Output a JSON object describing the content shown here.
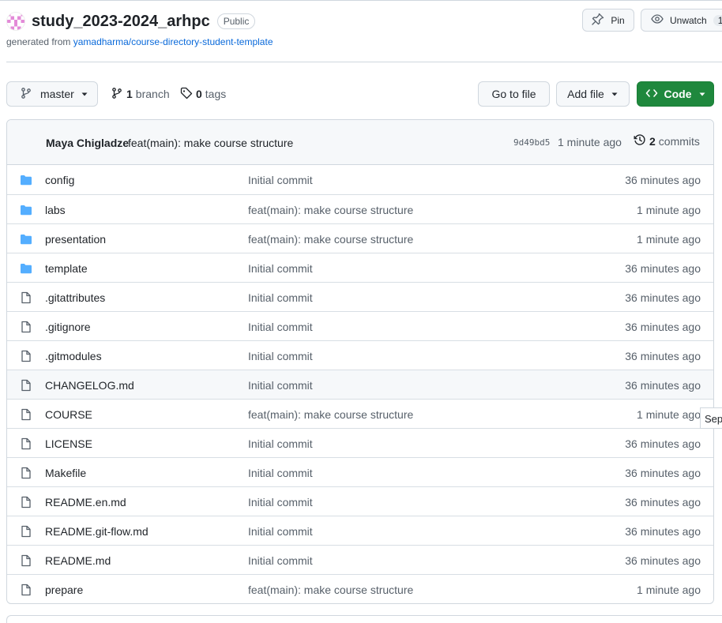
{
  "repo": {
    "name": "study_2023-2024_arhpc",
    "visibility": "Public",
    "generated_prefix": "generated from ",
    "template_link": "yamadharma/course-directory-student-template"
  },
  "actions": {
    "pin_label": "Pin",
    "unwatch_label": "Unwatch",
    "watch_count": "1"
  },
  "toolbar": {
    "branch_name": "master",
    "branch_count": "1",
    "branch_word": "branch",
    "tags_count": "0",
    "tags_word": "tags",
    "goto_label": "Go to file",
    "addfile_label": "Add file",
    "code_label": "Code"
  },
  "latest_commit": {
    "author": "Maya Chigladze",
    "message": "feat(main): make course structure",
    "sha": "9d49bd5",
    "time": "1 minute ago",
    "commits_count": "2",
    "commits_word": "commits"
  },
  "files": [
    {
      "name": "config",
      "type": "dir",
      "message": "Initial commit",
      "time": "36 minutes ago"
    },
    {
      "name": "labs",
      "type": "dir",
      "message": "feat(main): make course structure",
      "time": "1 minute ago"
    },
    {
      "name": "presentation",
      "type": "dir",
      "message": "feat(main): make course structure",
      "time": "1 minute ago"
    },
    {
      "name": "template",
      "type": "dir",
      "message": "Initial commit",
      "time": "36 minutes ago"
    },
    {
      "name": ".gitattributes",
      "type": "file",
      "message": "Initial commit",
      "time": "36 minutes ago"
    },
    {
      "name": ".gitignore",
      "type": "file",
      "message": "Initial commit",
      "time": "36 minutes ago"
    },
    {
      "name": ".gitmodules",
      "type": "file",
      "message": "Initial commit",
      "time": "36 minutes ago"
    },
    {
      "name": "CHANGELOG.md",
      "type": "file",
      "message": "Initial commit",
      "time": "36 minutes ago"
    },
    {
      "name": "COURSE",
      "type": "file",
      "message": "feat(main): make course structure",
      "time": "1 minute ago"
    },
    {
      "name": "LICENSE",
      "type": "file",
      "message": "Initial commit",
      "time": "36 minutes ago"
    },
    {
      "name": "Makefile",
      "type": "file",
      "message": "Initial commit",
      "time": "36 minutes ago"
    },
    {
      "name": "README.en.md",
      "type": "file",
      "message": "Initial commit",
      "time": "36 minutes ago"
    },
    {
      "name": "README.git-flow.md",
      "type": "file",
      "message": "Initial commit",
      "time": "36 minutes ago"
    },
    {
      "name": "README.md",
      "type": "file",
      "message": "Initial commit",
      "time": "36 minutes ago"
    },
    {
      "name": "prepare",
      "type": "file",
      "message": "feat(main): make course structure",
      "time": "1 minute ago"
    }
  ],
  "tooltip_text": "Sep",
  "colors": {
    "folder": "#54aeff",
    "code_button": "#1f883d",
    "link": "#0969da"
  },
  "icons": {
    "folder": "folder-icon",
    "file": "file-icon",
    "branch": "git-branch-icon",
    "tag": "tag-icon",
    "pin": "pin-icon",
    "eye": "eye-icon",
    "history": "history-icon",
    "code": "code-icon"
  }
}
